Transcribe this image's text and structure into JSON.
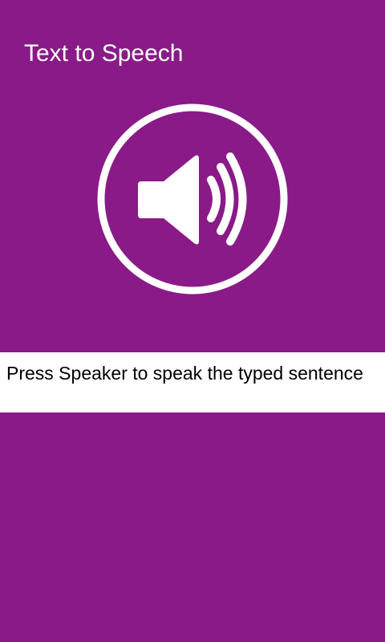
{
  "header": {
    "title": "Text to Speech"
  },
  "speaker": {
    "icon": "speaker-volume-icon"
  },
  "text_field": {
    "value": "Press Speaker to speak the typed sentence"
  },
  "colors": {
    "background": "#8a1a88",
    "foreground": "#ffffff",
    "text_field_background": "#ffffff",
    "text_field_text": "#000000"
  }
}
